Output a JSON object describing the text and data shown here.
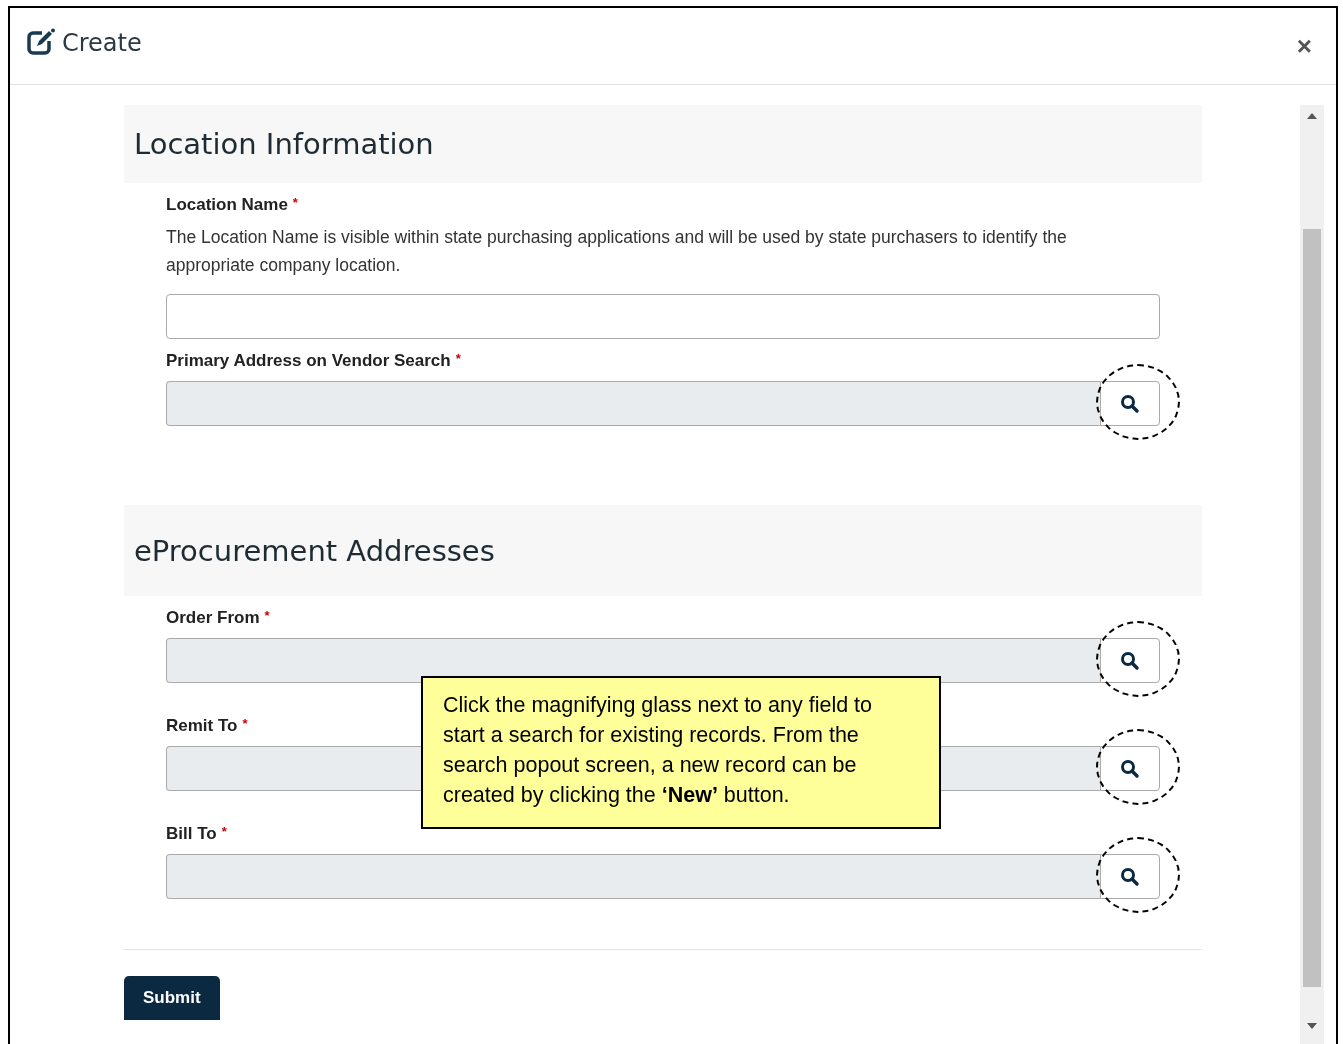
{
  "dialog": {
    "title": "Create",
    "close": "×"
  },
  "sections": [
    {
      "title": "Location Information",
      "fields": [
        {
          "kind": "text",
          "label": "Location Name",
          "required_marker": "*",
          "help": "The Location Name is visible within state purchasing applications and will be used by state purchasers to identify the appropriate company location."
        },
        {
          "kind": "lookup",
          "label": "Primary Address on Vendor Search",
          "required_marker": "*",
          "highlighted": true
        }
      ]
    },
    {
      "title": "eProcurement Addresses",
      "fields": [
        {
          "kind": "lookup",
          "label": "Order From",
          "required_marker": "*",
          "highlighted": true
        },
        {
          "kind": "lookup",
          "label": "Remit To",
          "required_marker": "*",
          "highlighted": true
        },
        {
          "kind": "lookup",
          "label": "Bill To",
          "required_marker": "*",
          "highlighted": true
        }
      ]
    }
  ],
  "callout": {
    "text": "Click the magnifying glass next to any field to start a search for existing records. From the search popout screen, a new record can be created by clicking the **‘New’** button."
  },
  "submit": "Submit"
}
